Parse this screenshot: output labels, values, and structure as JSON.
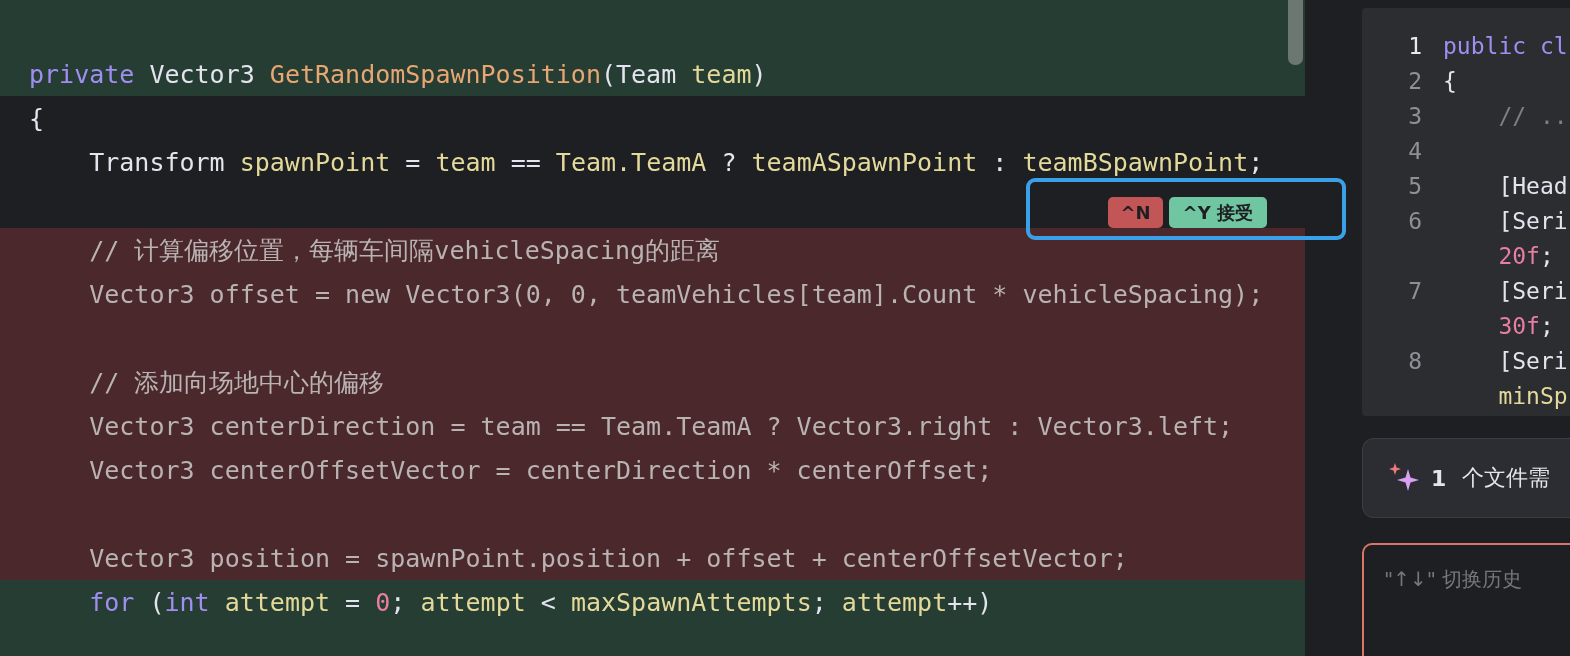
{
  "editor": {
    "lines": [
      {
        "kind": "added",
        "tokens": [
          {
            "kind": "kw",
            "text": "private"
          },
          {
            "kind": "plain",
            "text": " Vector3 "
          },
          {
            "kind": "fn",
            "text": "GetRandomSpawnPosition"
          },
          {
            "kind": "plain",
            "text": "(Team "
          },
          {
            "kind": "id",
            "text": "team"
          },
          {
            "kind": "plain",
            "text": ")"
          }
        ]
      },
      {
        "kind": "plain",
        "tokens": [
          {
            "kind": "plain",
            "text": "{"
          }
        ]
      },
      {
        "kind": "plain",
        "tokens": [
          {
            "kind": "plain",
            "text": "    Transform "
          },
          {
            "kind": "id",
            "text": "spawnPoint"
          },
          {
            "kind": "plain",
            "text": " = "
          },
          {
            "kind": "id",
            "text": "team"
          },
          {
            "kind": "plain",
            "text": " == "
          },
          {
            "kind": "id",
            "text": "Team.TeamA"
          },
          {
            "kind": "plain",
            "text": " ? "
          },
          {
            "kind": "id",
            "text": "teamASpawnPoint"
          },
          {
            "kind": "plain",
            "text": " : "
          },
          {
            "kind": "id",
            "text": "teamBSpawnPoint"
          },
          {
            "kind": "plain",
            "text": ";"
          }
        ]
      },
      {
        "kind": "plain"
      },
      {
        "kind": "removed",
        "tokens": [
          {
            "kind": "plain",
            "text": "    // 计算偏移位置，每辆车间隔vehicleSpacing的距离"
          }
        ]
      },
      {
        "kind": "removed",
        "tokens": [
          {
            "kind": "plain",
            "text": "    Vector3 offset = new Vector3(0, 0, teamVehicles[team].Count * vehicleSpacing);"
          }
        ]
      },
      {
        "kind": "removed"
      },
      {
        "kind": "removed",
        "tokens": [
          {
            "kind": "plain",
            "text": "    // 添加向场地中心的偏移"
          }
        ]
      },
      {
        "kind": "removed",
        "tokens": [
          {
            "kind": "plain",
            "text": "    Vector3 centerDirection = team == Team.TeamA ? Vector3.right : Vector3.left;"
          }
        ]
      },
      {
        "kind": "removed",
        "tokens": [
          {
            "kind": "plain",
            "text": "    Vector3 centerOffsetVector = centerDirection * centerOffset;"
          }
        ]
      },
      {
        "kind": "removed"
      },
      {
        "kind": "removed",
        "tokens": [
          {
            "kind": "plain",
            "text": "    Vector3 position = spawnPoint.position + offset + centerOffsetVector;"
          }
        ]
      },
      {
        "kind": "added",
        "tokens": [
          {
            "kind": "kw",
            "text": "    for"
          },
          {
            "kind": "plain",
            "text": " ("
          },
          {
            "kind": "kw",
            "text": "int"
          },
          {
            "kind": "id",
            "text": " attempt"
          },
          {
            "kind": "plain",
            "text": " = "
          },
          {
            "kind": "num",
            "text": "0"
          },
          {
            "kind": "plain",
            "text": "; "
          },
          {
            "kind": "id",
            "text": "attempt"
          },
          {
            "kind": "plain",
            "text": " < "
          },
          {
            "kind": "id",
            "text": "maxSpawnAttempts"
          },
          {
            "kind": "plain",
            "text": "; "
          },
          {
            "kind": "id",
            "text": "attempt"
          },
          {
            "kind": "plain",
            "text": "++)"
          }
        ]
      },
      {
        "kind": "added"
      }
    ],
    "actions": [
      {
        "kind": "reject",
        "label": "^N"
      },
      {
        "kind": "accept",
        "label": "^Y 接受"
      }
    ]
  },
  "preview": {
    "rows": [
      {
        "number": "1",
        "current": true,
        "tokens": [
          {
            "kind": "kw",
            "text": "public cl"
          }
        ]
      },
      {
        "number": "2",
        "current": false,
        "tokens": [
          {
            "kind": "plain",
            "text": "{"
          }
        ]
      },
      {
        "number": "3",
        "current": false,
        "tokens": [
          {
            "kind": "cmt",
            "text": "    // .."
          }
        ]
      },
      {
        "number": "4",
        "current": false,
        "tokens": []
      },
      {
        "number": "5",
        "current": false,
        "tokens": [
          {
            "kind": "plain",
            "text": "    [Head"
          }
        ]
      },
      {
        "number": "6",
        "current": false,
        "tokens": [
          {
            "kind": "plain",
            "text": "    [Seri"
          }
        ]
      },
      {
        "tokens": [
          {
            "kind": "num",
            "text": "    20f"
          },
          {
            "kind": "plain",
            "text": ";"
          }
        ]
      },
      {
        "number": "7",
        "current": false,
        "tokens": [
          {
            "kind": "plain",
            "text": "    [Seri"
          }
        ]
      },
      {
        "tokens": [
          {
            "kind": "num",
            "text": "    30f"
          },
          {
            "kind": "plain",
            "text": ";"
          }
        ]
      },
      {
        "number": "8",
        "current": false,
        "tokens": [
          {
            "kind": "plain",
            "text": "    [Seri"
          }
        ]
      },
      {
        "tokens": [
          {
            "kind": "id",
            "text": "    minSp"
          }
        ]
      }
    ]
  },
  "summary": {
    "count": "1",
    "text": "个文件需"
  },
  "prompt": {
    "placeholder": "\"↑↓\" 切换历史"
  }
}
